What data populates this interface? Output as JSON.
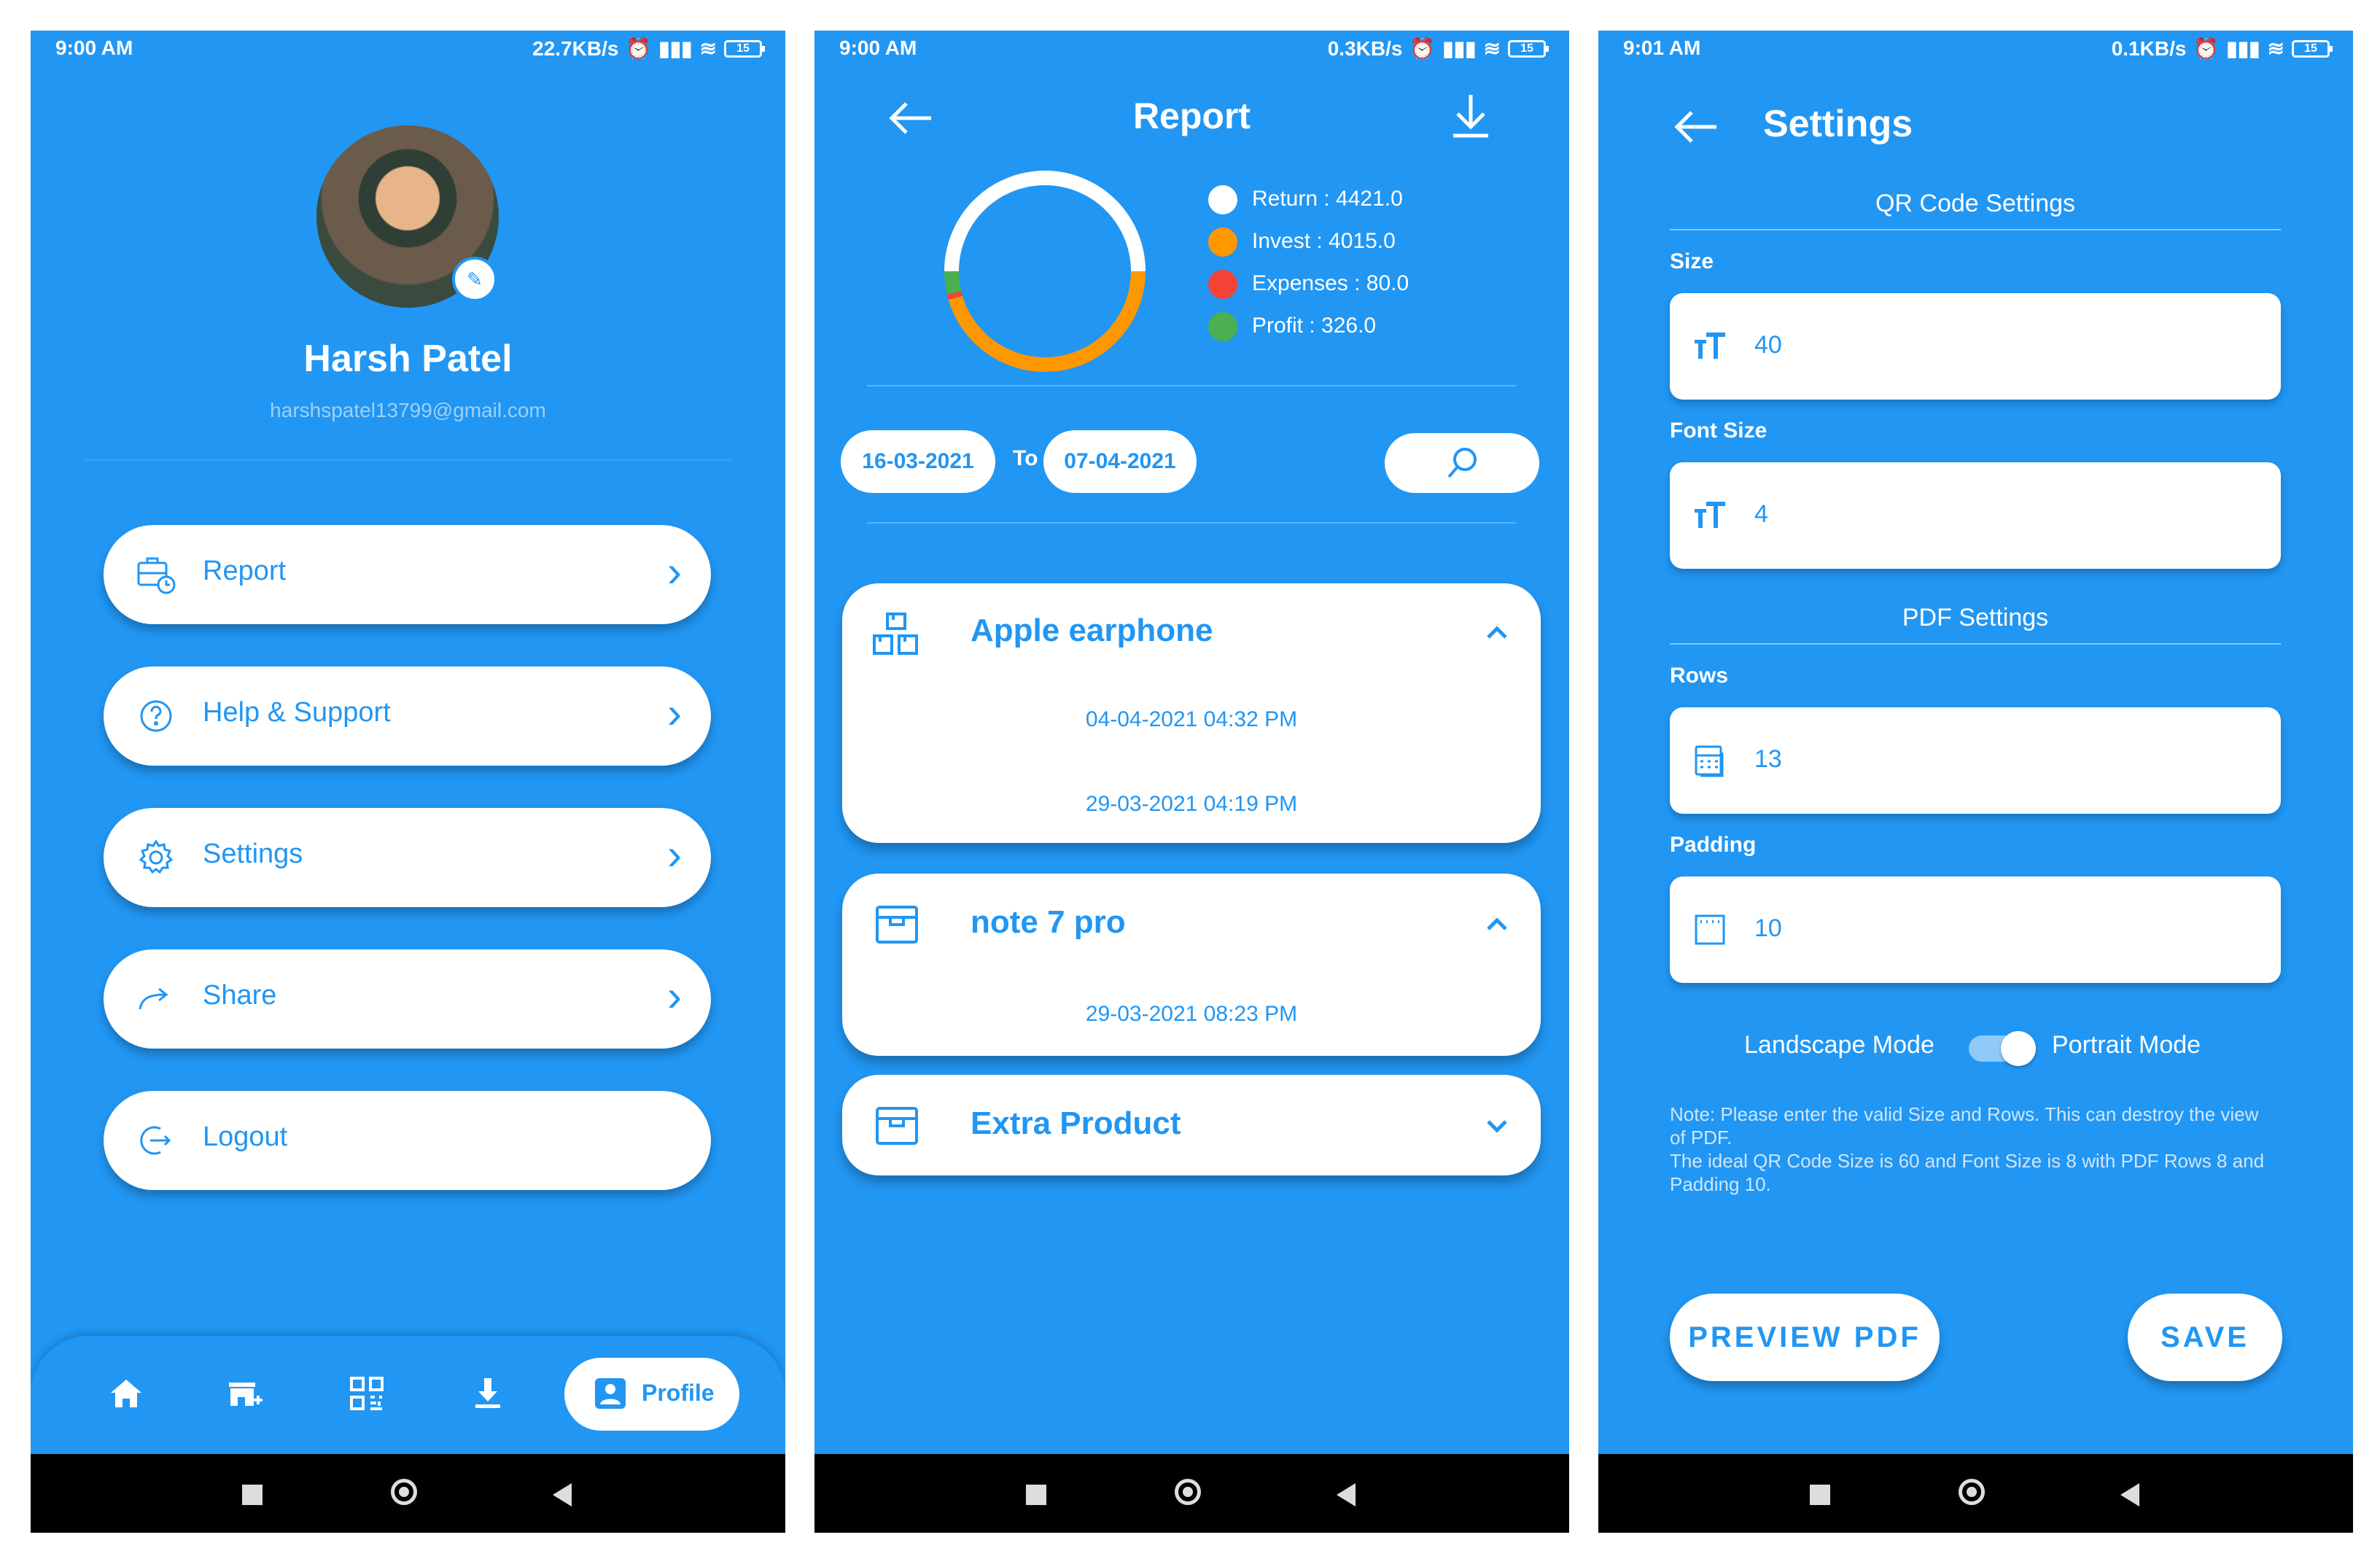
{
  "colors": {
    "primary": "#2196F3",
    "white": "#ffffff",
    "nav_black": "#000000"
  },
  "screens": {
    "profile": {
      "status": {
        "time": "9:00 AM",
        "speed": "22.7KB/s",
        "battery": "15"
      },
      "user": {
        "name": "Harsh Patel",
        "email": "harshspatel13799@gmail.com"
      },
      "menu": [
        {
          "label": "Report",
          "icon": "report-clock-icon"
        },
        {
          "label": "Help & Support",
          "icon": "help-circle-icon"
        },
        {
          "label": "Settings",
          "icon": "gear-icon"
        },
        {
          "label": "Share",
          "icon": "share-arrow-icon"
        },
        {
          "label": "Logout",
          "icon": "logout-icon"
        }
      ],
      "bottom_nav": {
        "active_label": "Profile",
        "items": [
          "home-icon",
          "add-store-icon",
          "qr-code-icon",
          "download-icon",
          "profile-icon"
        ]
      }
    },
    "report": {
      "status": {
        "time": "9:00 AM",
        "speed": "0.3KB/s",
        "battery": "15"
      },
      "title": "Report",
      "legend": [
        {
          "label": "Return : 4421.0",
          "color": "#ffffff"
        },
        {
          "label": "Invest : 4015.0",
          "color": "#FF9800"
        },
        {
          "label": "Expenses : 80.0",
          "color": "#F44336"
        },
        {
          "label": "Profit : 326.0",
          "color": "#4CAF50"
        }
      ],
      "chart_data": {
        "type": "pie",
        "categories": [
          "Return",
          "Invest",
          "Expenses",
          "Profit"
        ],
        "values": [
          4421.0,
          4015.0,
          80.0,
          326.0
        ],
        "colors": [
          "#ffffff",
          "#FF9800",
          "#F44336",
          "#4CAF50"
        ]
      },
      "date_from": "16-03-2021",
      "date_to": "07-04-2021",
      "to_label": "To",
      "products": [
        {
          "name": "Apple earphone",
          "expanded": true,
          "entries": [
            "04-04-2021 04:32 PM",
            "29-03-2021 04:19 PM"
          ]
        },
        {
          "name": "note 7 pro",
          "expanded": true,
          "entries": [
            "29-03-2021 08:23 PM"
          ]
        },
        {
          "name": "Extra Product",
          "expanded": false,
          "entries": []
        }
      ]
    },
    "settings": {
      "status": {
        "time": "9:01 AM",
        "speed": "0.1KB/s",
        "battery": "15"
      },
      "title": "Settings",
      "qr_section": "QR Code Settings",
      "pdf_section": "PDF Settings",
      "fields": {
        "size": {
          "label": "Size",
          "value": "40"
        },
        "font_size": {
          "label": "Font Size",
          "value": "4"
        },
        "rows": {
          "label": "Rows",
          "value": "13"
        },
        "padding": {
          "label": "Padding",
          "value": "10"
        }
      },
      "toggle": {
        "left_label": "Landscape Mode",
        "right_label": "Portrait Mode",
        "on": true
      },
      "note": "Note: Please enter the valid Size and Rows. This can destroy the view of PDF.\nThe ideal QR Code Size is 60 and Font Size is 8 with PDF Rows 8 and Padding 10.",
      "buttons": {
        "preview": "PREVIEW PDF",
        "save": "SAVE"
      }
    }
  }
}
